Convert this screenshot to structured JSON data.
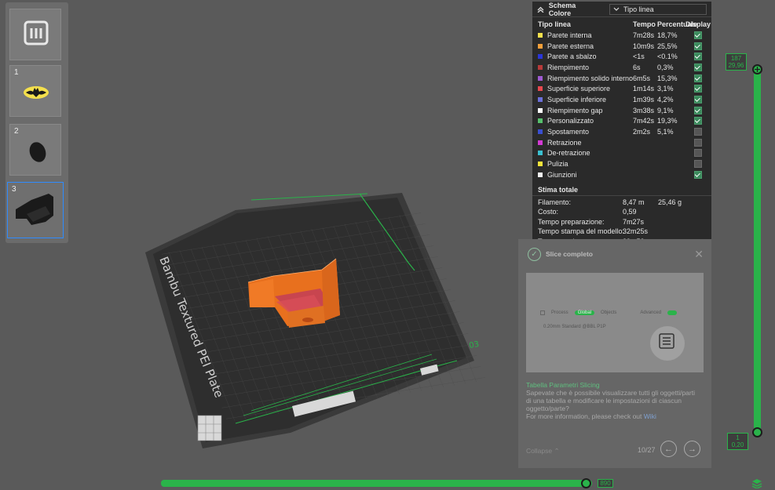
{
  "plates": [
    {
      "number": "1",
      "selected": false
    },
    {
      "number": "2",
      "selected": false
    },
    {
      "number": "3",
      "selected": true
    }
  ],
  "viewport": {
    "plate_label": "Bambu Textured PEI Plate",
    "plate_number": "03"
  },
  "color_scheme": {
    "title": "Schema Colore",
    "selected_view": "Tipo linea",
    "columns": {
      "type": "Tipo linea",
      "time": "Tempo",
      "percent": "Percentuale",
      "display": "Display"
    },
    "rows": [
      {
        "label": "Parete interna",
        "time": "7m28s",
        "percent": "18,7%",
        "color": "#f4e04d",
        "display": true
      },
      {
        "label": "Parete esterna",
        "time": "10m9s",
        "percent": "25,5%",
        "color": "#f29f3a",
        "display": true
      },
      {
        "label": "Parete a sbalzo",
        "time": "<1s",
        "percent": "<0.1%",
        "color": "#2a36d8",
        "display": true
      },
      {
        "label": "Riempimento",
        "time": "6s",
        "percent": "0,3%",
        "color": "#b83a3a",
        "display": true
      },
      {
        "label": "Riempimento solido interno",
        "time": "6m5s",
        "percent": "15,3%",
        "color": "#9e5ad2",
        "display": true
      },
      {
        "label": "Superficie superiore",
        "time": "1m14s",
        "percent": "3,1%",
        "color": "#e8484f",
        "display": true
      },
      {
        "label": "Superficie inferiore",
        "time": "1m39s",
        "percent": "4,2%",
        "color": "#6b6fd9",
        "display": true
      },
      {
        "label": "Riempimento gap",
        "time": "3m38s",
        "percent": "9,1%",
        "color": "#ffffff",
        "display": true
      },
      {
        "label": "Personalizzato",
        "time": "7m42s",
        "percent": "19,3%",
        "color": "#56c06c",
        "display": true
      },
      {
        "label": "Spostamento",
        "time": "2m2s",
        "percent": "5,1%",
        "color": "#3a4fd0",
        "display": false
      },
      {
        "label": "Retrazione",
        "time": "",
        "percent": "",
        "color": "#d43ad4",
        "display": false
      },
      {
        "label": "De-retrazione",
        "time": "",
        "percent": "",
        "color": "#3ac0d0",
        "display": false
      },
      {
        "label": "Pulizia",
        "time": "",
        "percent": "",
        "color": "#f2e33a",
        "display": false
      },
      {
        "label": "Giunzioni",
        "time": "",
        "percent": "",
        "color": "#f0f0f0",
        "display": true
      }
    ],
    "totals_title": "Stima totale",
    "totals": [
      {
        "key": "Filamento:",
        "v1": "8,47 m",
        "v2": "25,46 g"
      },
      {
        "key": "Costo:",
        "v1": "0,59",
        "v2": ""
      },
      {
        "key": "Tempo preparazione:",
        "v1": "7m27s",
        "v2": ""
      },
      {
        "key": "Tempo stampa del modello:",
        "v1": "32m25s",
        "v2": ""
      },
      {
        "key": "Tempo totale:",
        "v1": "39m52s",
        "v2": ""
      }
    ]
  },
  "notification": {
    "title": "Slice completo",
    "preview": {
      "process": "Process",
      "global": "Global",
      "objects": "Objects",
      "advanced": "Advanced",
      "preset": "0.20mm Standard @BBL P1P"
    },
    "tip_title": "Tabella Parametri Slicing",
    "tip_body": "Sapevate che è possibile visualizzare tutti gli oggetti/parti di una tabella e modificare le impostazioni di ciascun oggetto/parte?",
    "more_text": "For more information, please check out",
    "wiki": "Wiki",
    "collapse": "Collapse",
    "page": "10/27"
  },
  "layer_slider": {
    "top_layer": "187",
    "top_height": "29,96",
    "bottom_layer": "1",
    "bottom_height": "0,20"
  },
  "move_slider": {
    "value": "890"
  },
  "colors": {
    "accent": "#2ab34a",
    "panel": "#2a2a2a",
    "model": "#e8701e"
  }
}
